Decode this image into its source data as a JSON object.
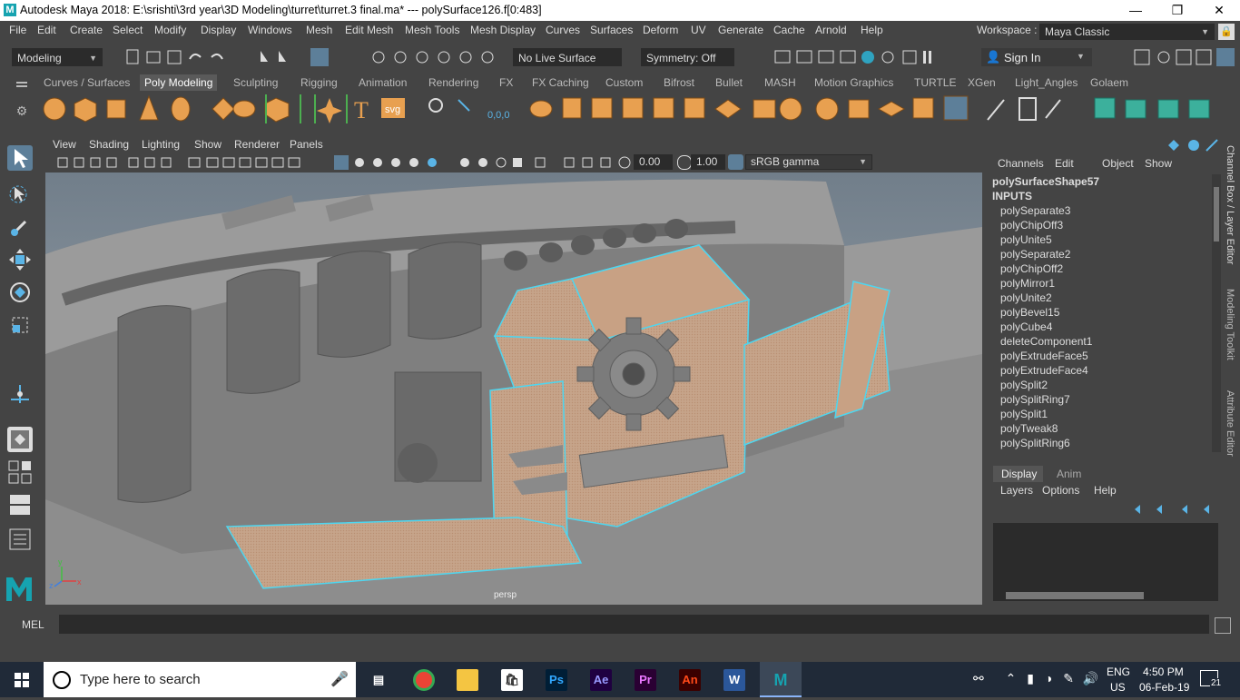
{
  "window": {
    "title": "Autodesk Maya 2018: E:\\srishti\\3rd year\\3D Modeling\\turret\\turret.3 final.ma*   ---   polySurface126.f[0:483]",
    "logo": "M"
  },
  "menu": [
    "File",
    "Edit",
    "Create",
    "Select",
    "Modify",
    "Display",
    "Windows",
    "Mesh",
    "Edit Mesh",
    "Mesh Tools",
    "Mesh Display",
    "Curves",
    "Surfaces",
    "Deform",
    "UV",
    "Generate",
    "Cache",
    "Arnold",
    "Help"
  ],
  "workspace": {
    "label": "Workspace :",
    "value": "Maya Classic"
  },
  "status_line": {
    "mode": "Modeling",
    "live_surface": "No Live Surface",
    "symmetry": "Symmetry: Off",
    "sign_in": "Sign In"
  },
  "shelf_tabs": [
    "Curves / Surfaces",
    "Poly Modeling",
    "Sculpting",
    "Rigging",
    "Animation",
    "Rendering",
    "FX",
    "FX Caching",
    "Custom",
    "Bifrost",
    "Bullet",
    "MASH",
    "Motion Graphics",
    "TURTLE",
    "XGen",
    "Light_Angles",
    "Golaem"
  ],
  "active_shelf_tab": "Poly Modeling",
  "shelf_icons": [
    "sphere-icon",
    "cube-icon",
    "cylinder-icon",
    "cone-icon",
    "torus-icon",
    "plane-icon",
    "disk-icon",
    "platonic-icon",
    "super-shape-icon",
    "type-icon",
    "svg-icon",
    "measure-icon",
    "uv-coordinates-icon",
    "combine-icon",
    "separate-icon",
    "extrude-icon",
    "bridge-icon",
    "bevel-icon",
    "append-icon",
    "fill-hole-icon",
    "make-hole-icon",
    "wedge-icon",
    "poke-icon",
    "smooth-icon",
    "mirror-icon",
    "triangulate-icon",
    "quadrangulate-icon",
    "merge-icon",
    "target-weld-icon",
    "multicut-icon",
    "edge-loop-icon",
    "offset-loop-icon",
    "uv-editor-icon",
    "planar-map-icon",
    "cylindrical-map-icon",
    "spherical-map-icon"
  ],
  "shelf_text": {
    "svg": "svg",
    "type": "T",
    "coords": "0,0,0"
  },
  "viewport": {
    "menu": [
      "View",
      "Shading",
      "Lighting",
      "Show",
      "Renderer",
      "Panels"
    ],
    "exposure": "0.00",
    "gamma": "1.00",
    "color_space": "sRGB gamma",
    "camera_label": "persp",
    "axis": {
      "x": "x",
      "y": "y",
      "z": "z"
    }
  },
  "channel_box": {
    "menu": [
      "Channels",
      "Edit",
      "Object",
      "Show"
    ],
    "shape": "polySurfaceShape57",
    "inputs_label": "INPUTS",
    "inputs": [
      "polySeparate3",
      "polyChipOff3",
      "polyUnite5",
      "polySeparate2",
      "polyChipOff2",
      "polyMirror1",
      "polyUnite2",
      "polyBevel15",
      "polyCube4",
      "deleteComponent1",
      "polyExtrudeFace5",
      "polyExtrudeFace4",
      "polySplit2",
      "polySplitRing7",
      "polySplit1",
      "polyTweak8",
      "polySplitRing6"
    ]
  },
  "side_tabs": [
    "Channel Box / Layer Editor",
    "Modeling Toolkit",
    "Attribute Editor"
  ],
  "layer_editor": {
    "tabs": [
      "Display",
      "Anim"
    ],
    "active_tab": "Display",
    "menu": [
      "Layers",
      "Options",
      "Help"
    ]
  },
  "command_line": {
    "label": "MEL",
    "value": ""
  },
  "taskbar": {
    "search_placeholder": "Type here to search",
    "apps": [
      {
        "name": "task-view-icon",
        "label": ""
      },
      {
        "name": "chrome-icon",
        "label": ""
      },
      {
        "name": "file-explorer-icon",
        "label": ""
      },
      {
        "name": "store-icon",
        "label": ""
      },
      {
        "name": "photoshop-icon",
        "label": "Ps"
      },
      {
        "name": "after-effects-icon",
        "label": "Ae"
      },
      {
        "name": "premiere-icon",
        "label": "Pr"
      },
      {
        "name": "animate-icon",
        "label": "An"
      },
      {
        "name": "word-icon",
        "label": "W"
      },
      {
        "name": "maya-icon",
        "label": "M"
      }
    ],
    "lang_top": "ENG",
    "lang_bottom": "US",
    "time": "4:50 PM",
    "date": "06-Feb-19",
    "notifications": "21"
  },
  "colors": {
    "accent": "#16a3b0",
    "selection_wire": "#4dd6f0",
    "face_highlight": "#c8a184",
    "active_tab": "#5a5a5a",
    "background": "#444444"
  }
}
